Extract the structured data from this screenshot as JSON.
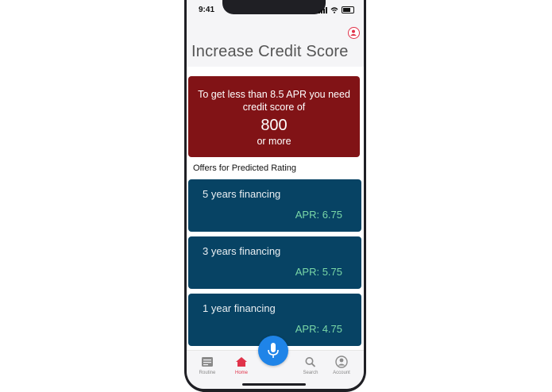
{
  "status_bar": {
    "time": "9:41"
  },
  "header": {
    "title": "Increase Credit Score",
    "profile_icon": "profile-icon"
  },
  "score_card": {
    "message": "To get less than 8.5 APR you need credit score of",
    "score": "800",
    "suffix": "or more",
    "color": "#811316"
  },
  "offers": {
    "title": "Offers for Predicted Rating",
    "items": [
      {
        "label": "5 years financing",
        "apr": "APR: 6.75"
      },
      {
        "label": "3 years financing",
        "apr": "APR: 5.75"
      },
      {
        "label": "1 year financing",
        "apr": "APR: 4.75"
      }
    ],
    "card_color": "#074364",
    "apr_color": "#79d7a7"
  },
  "tab_bar": {
    "items": [
      {
        "label": "Routine",
        "icon": "routine-icon"
      },
      {
        "label": "Home",
        "icon": "home-icon",
        "active": true
      },
      {
        "label": "Search",
        "icon": "search-icon"
      },
      {
        "label": "Account",
        "icon": "account-icon"
      }
    ],
    "active_color": "#e0334a",
    "mic_icon": "mic-icon",
    "mic_color": "#1f84e8"
  }
}
